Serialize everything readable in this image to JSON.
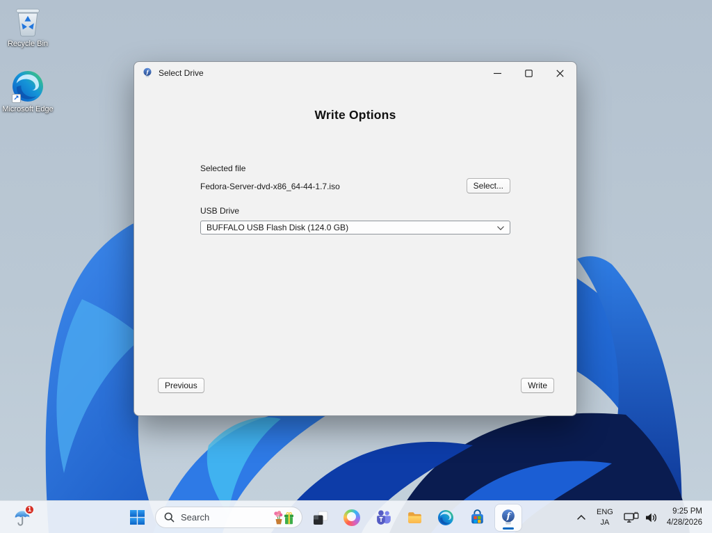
{
  "desktop": {
    "icons": [
      {
        "label": "Recycle Bin"
      },
      {
        "label": "Microsoft Edge"
      }
    ]
  },
  "window": {
    "title": "Select Drive",
    "heading": "Write Options",
    "file": {
      "label": "Selected file",
      "value": "Fedora-Server-dvd-x86_64-44-1.7.iso",
      "select_button": "Select..."
    },
    "usb": {
      "label": "USB Drive",
      "value": "BUFFALO USB Flash Disk (124.0 GB)"
    },
    "nav": {
      "previous": "Previous",
      "write": "Write"
    }
  },
  "taskbar": {
    "widgets": {
      "badge": "1"
    },
    "search": {
      "label": "Search"
    },
    "apps": [
      {
        "name": "task-view"
      },
      {
        "name": "copilot"
      },
      {
        "name": "teams"
      },
      {
        "name": "file-explorer"
      },
      {
        "name": "edge"
      },
      {
        "name": "microsoft-store"
      },
      {
        "name": "fedora-media-writer",
        "active": true
      }
    ],
    "tray": {
      "lang_primary": "ENG",
      "lang_secondary": "JA",
      "time": "9:25 PM",
      "date": "4/28/2026"
    }
  },
  "colors": {
    "accent": "#0067c0",
    "window_bg": "#f2f2f2",
    "taskbar_bg": "#f1f4f9",
    "bloom_blue": "#1b66d8",
    "bloom_dark": "#0a1d50"
  }
}
